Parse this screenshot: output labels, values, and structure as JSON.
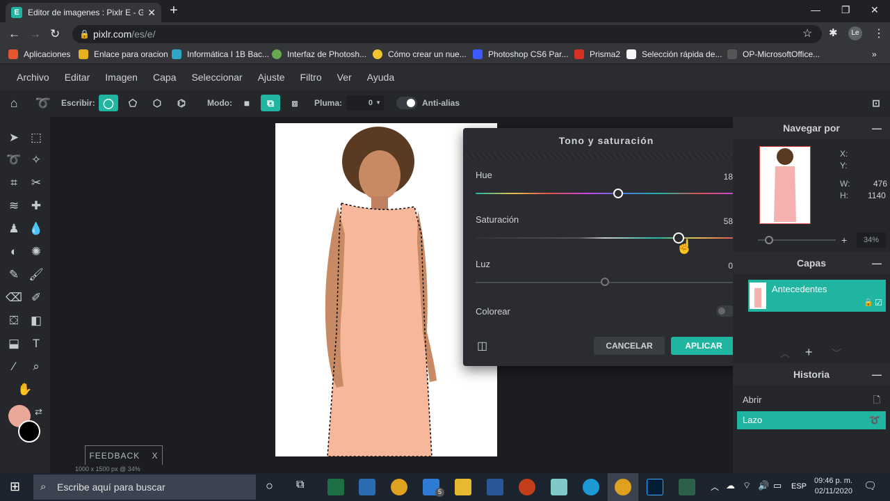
{
  "browser": {
    "tab_title": "Editor de imagenes : Pixlr E - Gra",
    "url_host": "pixlr.com",
    "url_path": "/es/e/",
    "profile_initials": "Le",
    "bookmarks": [
      "Aplicaciones",
      "Enlace para oracion",
      "Informática I 1B Bac...",
      "Interfaz de Photosh...",
      "Cómo crear un nue...",
      "Photoshop CS6 Par...",
      "Prisma2",
      "Selección rápida de...",
      "OP-MicrosoftOffice..."
    ]
  },
  "menu": [
    "Archivo",
    "Editar",
    "Imagen",
    "Capa",
    "Seleccionar",
    "Ajuste",
    "Filtro",
    "Ver",
    "Ayuda"
  ],
  "tool_options": {
    "write_label": "Escribir:",
    "mode_label": "Modo:",
    "feather_label": "Pluma:",
    "feather_value": "0",
    "antialias_label": "Anti-alias"
  },
  "canvas": {
    "feedback_label": "FEEDBACK",
    "feedback_close": "X",
    "image_info": "1000 x 1500 px @ 34%"
  },
  "colors": {
    "foreground": "#e8a898",
    "background": "#000000",
    "accent": "#1fb5a0"
  },
  "dialog": {
    "title": "Tono y saturación",
    "hue_label": "Hue",
    "hue_value": "18",
    "saturation_label": "Saturación",
    "saturation_value": "58",
    "light_label": "Luz",
    "light_value": "0",
    "colorize_label": "Colorear",
    "cancel_label": "CANCELAR",
    "apply_label": "APLICAR"
  },
  "navigator": {
    "title": "Navegar por",
    "x_label": "X:",
    "y_label": "Y:",
    "w_label": "W:",
    "w_value": "476",
    "h_label": "H:",
    "h_value": "1140",
    "zoom": "34%"
  },
  "layers": {
    "title": "Capas",
    "items": [
      "Antecedentes"
    ]
  },
  "history": {
    "title": "Historia",
    "items": [
      "Abrir",
      "Lazo"
    ]
  },
  "taskbar": {
    "search_placeholder": "Escribe aquí para buscar",
    "lang": "ESP",
    "time": "09:46 p. m.",
    "date": "02/11/2020",
    "mail_badge": "5"
  }
}
